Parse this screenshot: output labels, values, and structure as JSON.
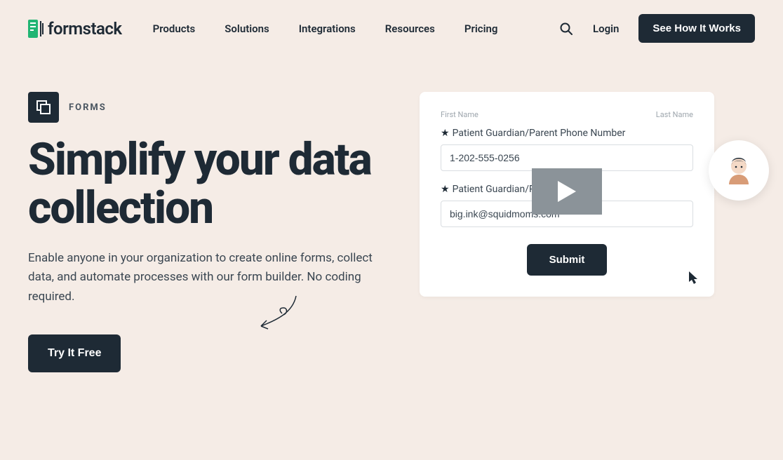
{
  "brand": "formstack",
  "nav": {
    "items": [
      "Products",
      "Solutions",
      "Integrations",
      "Resources",
      "Pricing"
    ]
  },
  "header": {
    "login": "Login",
    "cta": "See How It Works"
  },
  "hero": {
    "badge": "FORMS",
    "title": "Simplify your data collection",
    "subtitle": "Enable anyone in your organization to create online forms, collect data, and automate processes with our form builder. No coding required.",
    "try": "Try It Free"
  },
  "preview": {
    "first_name_label": "First Name",
    "last_name_label": "Last Name",
    "phone_label": "Patient Guardian/Parent Phone Number",
    "phone_value": "1-202-555-0256",
    "email_label": "Patient Guardian/Parent Email",
    "email_value": "big.ink@squidmoms.com",
    "submit": "Submit"
  }
}
